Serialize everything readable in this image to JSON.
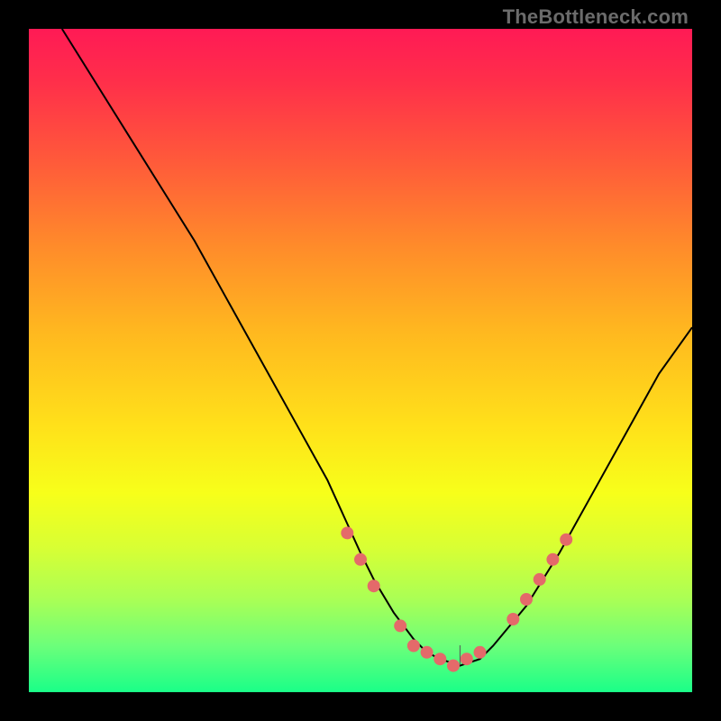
{
  "attribution": "TheBottleneck.com",
  "colors": {
    "page_bg": "#000000",
    "curve": "#000000",
    "dots": "#e46a6a",
    "gradient_top": "#ff1a55",
    "gradient_bottom": "#1aff88",
    "attribution_text": "#6b6b6b"
  },
  "chart_data": {
    "type": "line",
    "title": "",
    "xlabel": "",
    "ylabel": "",
    "xlim": [
      0,
      100
    ],
    "ylim": [
      0,
      100
    ],
    "grid": false,
    "legend": false,
    "x": [
      5,
      10,
      15,
      20,
      25,
      30,
      35,
      40,
      45,
      50,
      52,
      55,
      58,
      60,
      62,
      65,
      68,
      70,
      75,
      80,
      85,
      90,
      95,
      100
    ],
    "y": [
      100,
      92,
      84,
      76,
      68,
      59,
      50,
      41,
      32,
      21,
      17,
      12,
      8,
      6,
      5,
      4,
      5,
      7,
      13,
      21,
      30,
      39,
      48,
      55
    ],
    "highlight_points": [
      {
        "x": 48,
        "y": 24
      },
      {
        "x": 50,
        "y": 20
      },
      {
        "x": 52,
        "y": 16
      },
      {
        "x": 56,
        "y": 10
      },
      {
        "x": 58,
        "y": 7
      },
      {
        "x": 60,
        "y": 6
      },
      {
        "x": 62,
        "y": 5
      },
      {
        "x": 64,
        "y": 4
      },
      {
        "x": 66,
        "y": 5
      },
      {
        "x": 68,
        "y": 6
      },
      {
        "x": 73,
        "y": 11
      },
      {
        "x": 75,
        "y": 14
      },
      {
        "x": 77,
        "y": 17
      },
      {
        "x": 79,
        "y": 20
      },
      {
        "x": 81,
        "y": 23
      }
    ],
    "annotation_tick_x": 65
  }
}
